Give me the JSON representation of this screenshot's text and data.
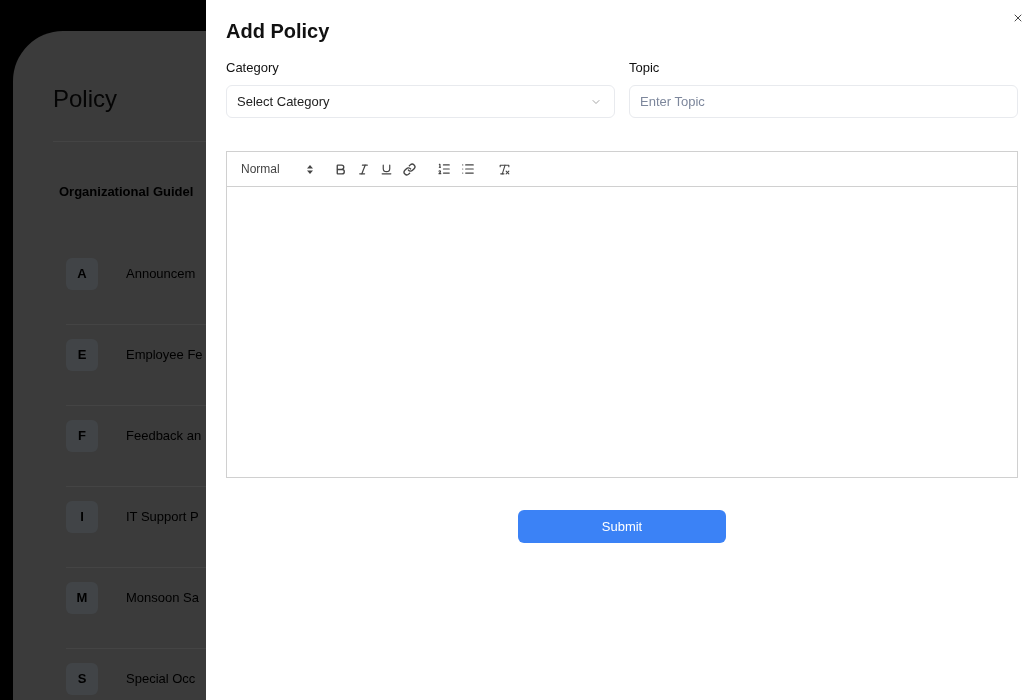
{
  "background_page": {
    "title": "Policy",
    "section_heading": "Organizational Guidel",
    "items": [
      {
        "initial": "A",
        "name": "Announcem"
      },
      {
        "initial": "E",
        "name": "Employee Fe"
      },
      {
        "initial": "F",
        "name": "Feedback an"
      },
      {
        "initial": "I",
        "name": "IT Support P"
      },
      {
        "initial": "M",
        "name": "Monsoon Sa"
      },
      {
        "initial": "S",
        "name": "Special Occ"
      }
    ]
  },
  "drawer": {
    "title": "Add Policy",
    "fields": [
      {
        "kind": "select",
        "label": "Category",
        "value": "Select Category"
      },
      {
        "kind": "text",
        "label": "Topic",
        "placeholder": "Enter Topic"
      }
    ],
    "editor": {
      "format": "Normal"
    },
    "submit": "Submit"
  }
}
